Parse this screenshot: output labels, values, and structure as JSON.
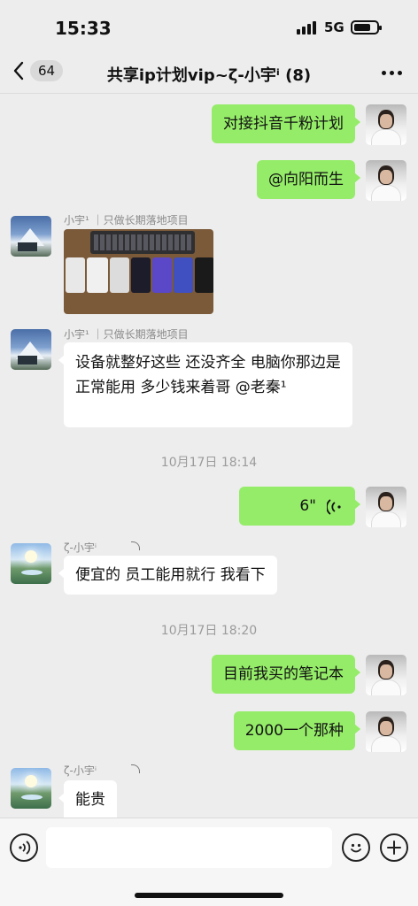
{
  "status_bar": {
    "time": "15:33",
    "network": "5G",
    "battery_level": 0.75
  },
  "nav": {
    "unread_count": "64",
    "title": "共享ip计划vip~ζ-小宇ⁱ  (8)",
    "back_icon": "chevron-left-icon",
    "more_icon": "ellipsis-icon"
  },
  "messages": [
    {
      "type": "text",
      "direction": "out",
      "text": "对接抖音千粉计划"
    },
    {
      "type": "text",
      "direction": "out",
      "text": "@向阳而生"
    },
    {
      "type": "image",
      "direction": "in",
      "sender": "小宇¹ ｜只做长期落地项目",
      "image": "photo of keyboard and phones"
    },
    {
      "type": "text",
      "direction": "in",
      "sender": "小宇¹ ｜只做长期落地项目",
      "text": "设备就整好这些 还没齐全 电脑你那边是正常能用 多少钱来着哥 @老秦¹"
    },
    {
      "type": "time",
      "text": "10月17日 18:14"
    },
    {
      "type": "voice",
      "direction": "out",
      "duration": "6\""
    },
    {
      "type": "text",
      "direction": "in",
      "sender": "ζ-小宇ⁱ",
      "text": "便宜的 员工能用就行 我看下"
    },
    {
      "type": "time",
      "text": "10月17日 18:20"
    },
    {
      "type": "text",
      "direction": "out",
      "text": "目前我买的笔记本"
    },
    {
      "type": "text",
      "direction": "out",
      "text": "2000一个那种"
    },
    {
      "type": "text",
      "direction": "in",
      "sender": "ζ-小宇ⁱ",
      "text": "能贵"
    }
  ],
  "input_bar": {
    "voice_icon": "voice-icon",
    "emoji_icon": "emoji-icon",
    "plus_icon": "plus-icon",
    "value": ""
  },
  "colors": {
    "outgoing_bubble": "#95ec69",
    "incoming_bubble": "#ffffff",
    "background": "#ededed"
  }
}
